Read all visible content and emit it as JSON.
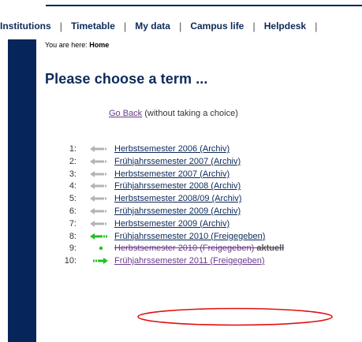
{
  "nav": {
    "items": [
      "Institutions",
      "Timetable",
      "My data",
      "Campus life",
      "Helpdesk"
    ],
    "separator": "|"
  },
  "breadcrumb": {
    "prefix": "You are here:",
    "current": "Home"
  },
  "page_title": "Please choose a term ...",
  "back": {
    "link": "Go Back",
    "suffix": "(without taking a choice)"
  },
  "terms": [
    {
      "num": "1:",
      "label": "Herbstsemester 2006 (Archiv)",
      "arrow": "gray"
    },
    {
      "num": "2:",
      "label": "Frühjahrssemester 2007 (Archiv)",
      "arrow": "gray"
    },
    {
      "num": "3:",
      "label": "Herbstsemester 2007 (Archiv)",
      "arrow": "gray"
    },
    {
      "num": "4:",
      "label": "Frühjahrssemester 2008 (Archiv)",
      "arrow": "gray"
    },
    {
      "num": "5:",
      "label": "Herbstsemester 2008/09 (Archiv)",
      "arrow": "gray"
    },
    {
      "num": "6:",
      "label": "Frühjahrssemester 2009 (Archiv)",
      "arrow": "gray"
    },
    {
      "num": "7:",
      "label": "Herbstsemester 2009 (Archiv)",
      "arrow": "gray"
    },
    {
      "num": "8:",
      "label": "Frühjahrssemester 2010 (Freigegeben)",
      "arrow": "green-left"
    },
    {
      "num": "9:",
      "label": "Herbstsemester 2010 (Freigegeben)",
      "arrow": "green-dot",
      "badge": "aktuell"
    },
    {
      "num": "10:",
      "label": "Frühjahrssemester 2011 (Freigegeben)",
      "arrow": "green-right"
    }
  ],
  "colors": {
    "navy": "#06265a",
    "link": "#0d2a5a",
    "visited": "#6a3a8a",
    "arrow_gray": "#b4b4b4",
    "arrow_green": "#22c022",
    "highlight_oval": "#e01010"
  }
}
